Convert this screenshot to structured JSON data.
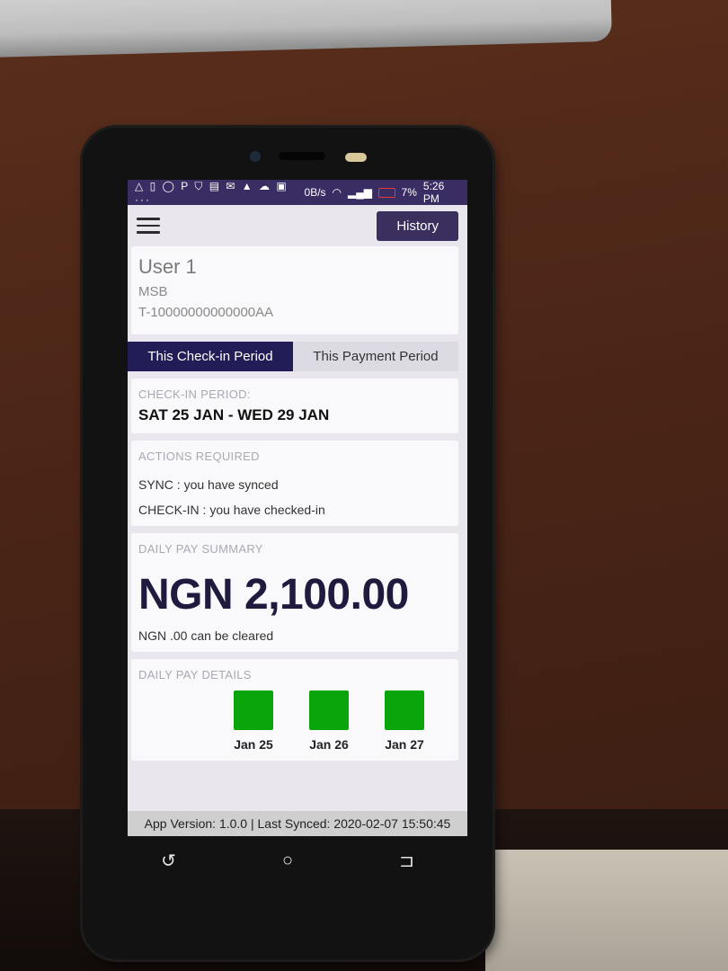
{
  "statusbar": {
    "left_icons": "△ ▯ ◯ P ⛉ ▤ ✉ ▲ ☁ ▣ ···",
    "data_rate": "0B/s",
    "battery": "7%",
    "time": "5:26 PM"
  },
  "appbar": {
    "history_label": "History"
  },
  "user": {
    "name": "User 1",
    "org": "MSB",
    "id": "T-10000000000000AA"
  },
  "tabs": [
    {
      "label": "This Check-in Period",
      "active": true
    },
    {
      "label": "This Payment Period",
      "active": false
    }
  ],
  "checkin": {
    "label": "CHECK-IN PERIOD:",
    "value": "SAT 25 JAN - WED 29 JAN"
  },
  "actions": {
    "label": "ACTIONS REQUIRED",
    "items": [
      "SYNC : you have synced",
      "CHECK-IN : you have checked-in"
    ]
  },
  "summary": {
    "label": "DAILY PAY SUMMARY",
    "amount": "NGN 2,100.00",
    "clearable": "NGN .00 can be cleared"
  },
  "details": {
    "label": "DAILY PAY DETAILS",
    "days": [
      "Jan 25",
      "Jan 26",
      "Jan 27"
    ],
    "status_color": "#0aa50a"
  },
  "footer": {
    "text": "App Version: 1.0.0 | Last Synced: 2020-02-07 15:50:45"
  },
  "navbar": {
    "back_icon": "↺",
    "home_icon": "○",
    "recents_icon": "⊐"
  }
}
